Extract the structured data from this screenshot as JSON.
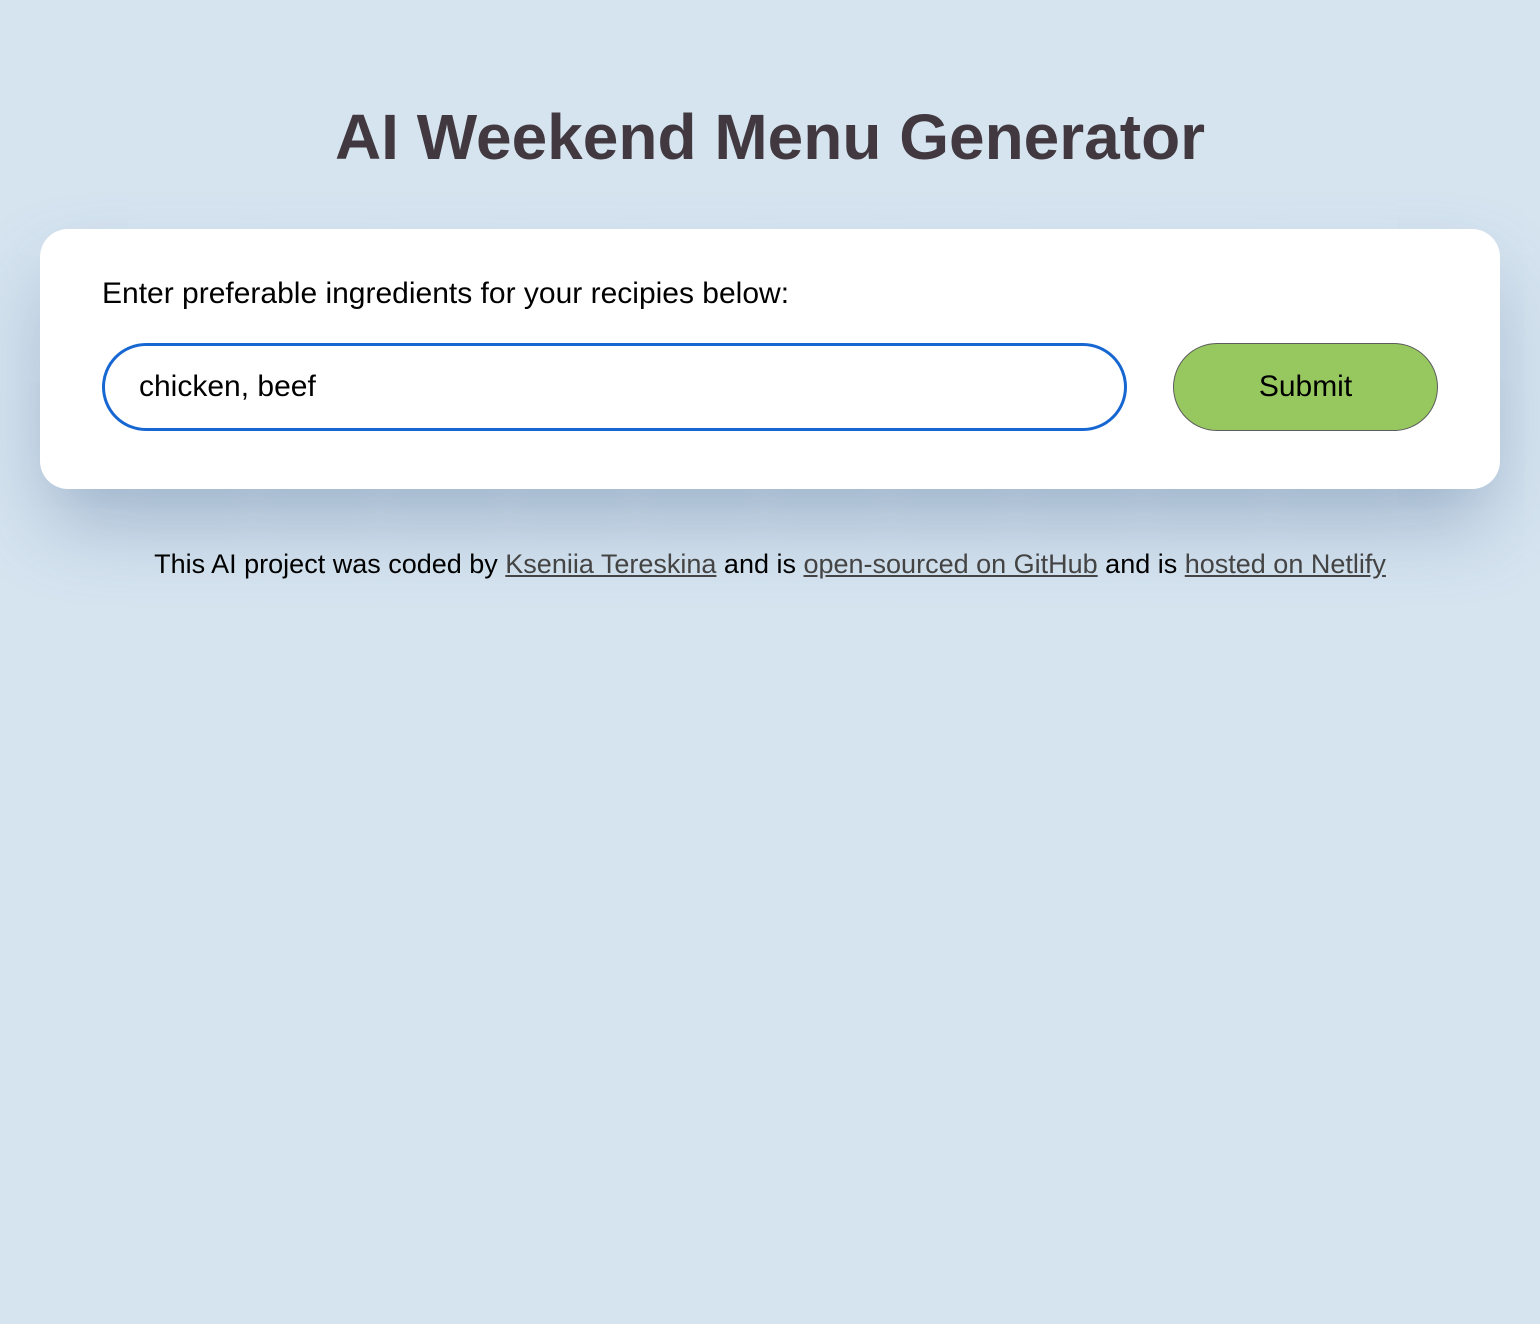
{
  "header": {
    "title": "AI Weekend Menu Generator"
  },
  "form": {
    "label": "Enter preferable ingredients for your recipies below:",
    "input_placeholder": "chicken, beef",
    "input_value": "",
    "submit_label": "Submit"
  },
  "footer": {
    "prefix": "This AI project was coded by ",
    "author": "Kseniia Tereskina",
    "mid1": " and is ",
    "link1": "open-sourced on GitHub",
    "mid2": " and is ",
    "link2": "hosted on Netlify"
  }
}
